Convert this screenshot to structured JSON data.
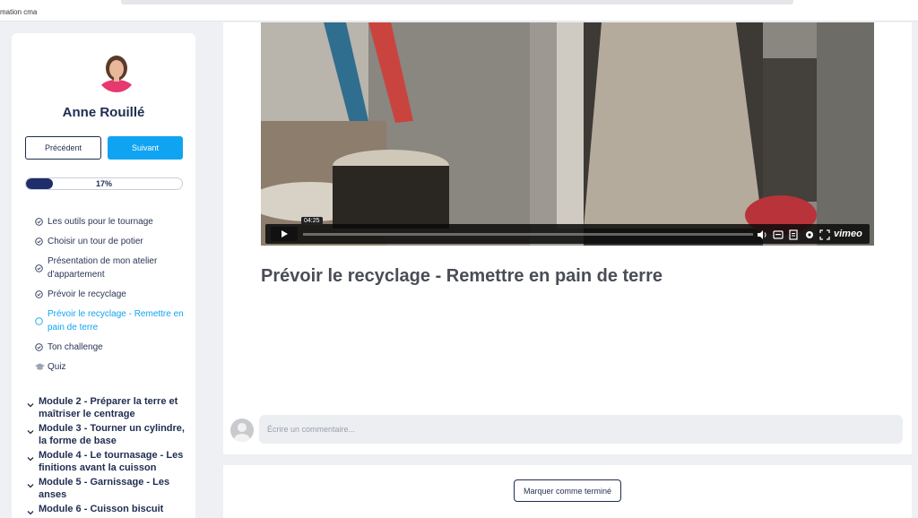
{
  "browser": {
    "tab_title": "mation cma"
  },
  "sidebar": {
    "instructor_name": "Anne Rouillé",
    "prev_label": "Précédent",
    "next_label": "Suivant",
    "progress": {
      "value": 17,
      "label": "17%"
    },
    "lessons": [
      {
        "label": "Les outils pour le tournage",
        "status": "done"
      },
      {
        "label": "Choisir un tour de potier",
        "status": "done"
      },
      {
        "label": "Présentation de mon atelier d'appartement",
        "status": "done"
      },
      {
        "label": "Prévoir le recyclage",
        "status": "done"
      },
      {
        "label": "Prévoir le recyclage - Remettre en pain de terre",
        "status": "current"
      },
      {
        "label": "Ton challenge",
        "status": "done"
      },
      {
        "label": "Quiz",
        "status": "quiz"
      }
    ],
    "modules": [
      {
        "label": "Module 2 - Préparer la terre et maîtriser le centrage"
      },
      {
        "label": "Module 3 - Tourner un cylindre, la forme de base"
      },
      {
        "label": "Module 4 - Le tournasage - Les finitions avant la cuisson"
      },
      {
        "label": "Module 5 - Garnissage - Les anses"
      },
      {
        "label": "Module 6 - Cuisson biscuit"
      }
    ]
  },
  "video": {
    "time": "04:25",
    "brand": "vimeo"
  },
  "main": {
    "lesson_title": "Prévoir le recyclage - Remettre en pain de terre",
    "comment_placeholder": "Écrire un commentaire...",
    "complete_label": "Marquer comme terminé"
  },
  "colors": {
    "accent": "#0fa4f2",
    "navy": "#1f2d50",
    "progress": "#1f2d6a"
  }
}
